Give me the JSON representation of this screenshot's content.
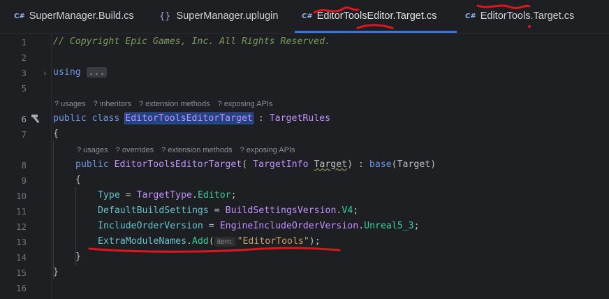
{
  "tabs": [
    {
      "icon": "C#",
      "label": "SuperManager.Build.cs",
      "active": false
    },
    {
      "icon": "{}",
      "label": "SuperManager.uplugin",
      "active": false
    },
    {
      "icon": "C#",
      "label": "EditorToolsEditor.Target.cs",
      "active": true
    },
    {
      "icon": "C#",
      "label": "EditorTools.Target.cs",
      "active": false
    }
  ],
  "line_numbers": [
    "1",
    "2",
    "3",
    "5",
    "6",
    "7",
    "8",
    "9",
    "10",
    "11",
    "12",
    "13",
    "14",
    "15",
    "16"
  ],
  "code": {
    "l1": "// Copyright Epic Games, Inc. All Rights Reserved.",
    "l3_kw": "using",
    "l3_fold": "...",
    "hints_class": [
      "? usages",
      "? inheritors",
      "? extension methods",
      "? exposing APIs"
    ],
    "l6_kw1": "public",
    "l6_kw2": "class",
    "l6_name": "EditorToolsEditorTarget",
    "l6_sep": " : ",
    "l6_base": "TargetRules",
    "l7": "{",
    "hints_ctor": [
      "? usages",
      "? overrides",
      "? extension methods",
      "? exposing APIs"
    ],
    "l8_kw": "public",
    "l8_name": "EditorToolsEditorTarget",
    "l8_open": "( ",
    "l8_ptype": "TargetInfo",
    "l8_pname": "Target",
    "l8_close": ") : ",
    "l8_base": "base",
    "l8_args": "(Target)",
    "l9": "{",
    "l10_a": "Type",
    "l10_b": " = ",
    "l10_c": "TargetType",
    "l10_d": ".",
    "l10_e": "Editor",
    "l10_f": ";",
    "l11_a": "DefaultBuildSettings",
    "l11_b": " = ",
    "l11_c": "BuildSettingsVersion",
    "l11_d": ".",
    "l11_e": "V4",
    "l11_f": ";",
    "l12_a": "IncludeOrderVersion",
    "l12_b": " = ",
    "l12_c": "EngineIncludeOrderVersion",
    "l12_d": ".",
    "l12_e": "Unreal5_3",
    "l12_f": ";",
    "l13_a": "ExtraModuleNames",
    "l13_b": ".",
    "l13_c": "Add",
    "l13_d": "(",
    "l13_inlay": "item:",
    "l13_str": "\"EditorTools\"",
    "l13_end": ");",
    "l14": "}",
    "l15": "}"
  },
  "colors": {
    "background": "#1e1f22",
    "keyword": "#6c95eb",
    "type": "#c191ff",
    "method": "#39cc9b",
    "string": "#c9a26d",
    "comment": "#7a9a5d",
    "active_tab_underline": "#3574f0",
    "annotation_red": "#e0161f"
  },
  "icons": {
    "tab_cs": "csharp-file-icon",
    "tab_uplugin": "json-braces-icon",
    "gutter_line6": "hammer-icon",
    "fold_line3": "chevron-right-icon"
  }
}
